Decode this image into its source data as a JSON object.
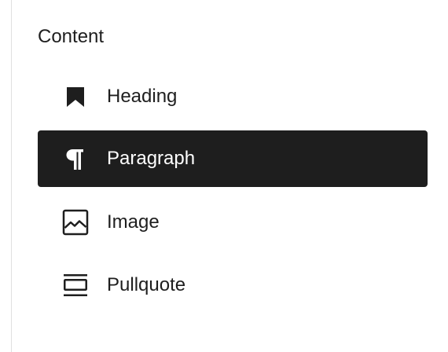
{
  "panel": {
    "title": "Content",
    "items": [
      {
        "label": "Heading",
        "icon": "bookmark-icon",
        "active": false
      },
      {
        "label": "Paragraph",
        "icon": "pilcrow-icon",
        "active": true
      },
      {
        "label": "Image",
        "icon": "image-icon",
        "active": false
      },
      {
        "label": "Pullquote",
        "icon": "pullquote-icon",
        "active": false
      }
    ]
  },
  "colors": {
    "active_background": "#1e1e1e",
    "active_text": "#ffffff",
    "text": "#1e1e1e",
    "divider": "#e0e0e0"
  }
}
